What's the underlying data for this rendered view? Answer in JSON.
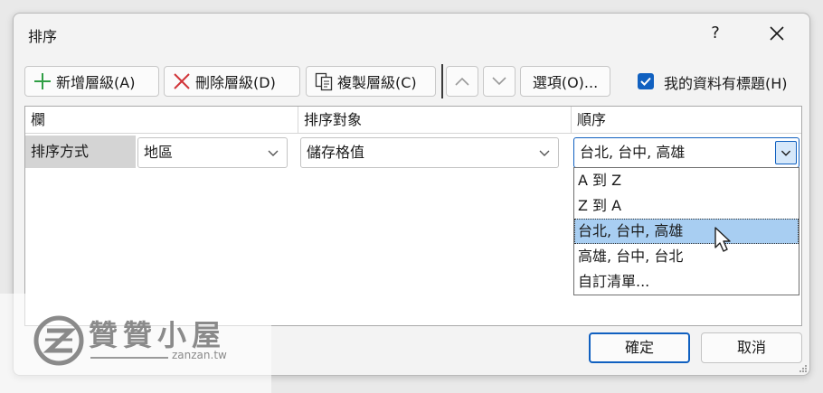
{
  "dialog": {
    "title": "排序",
    "help_label": "?"
  },
  "toolbar": {
    "add_level": "新增層級(A)",
    "delete_level": "刪除層級(D)",
    "copy_level": "複製層級(C)",
    "options": "選項(O)...",
    "header_checkbox_label": "我的資料有標題(H)",
    "header_checkbox_checked": true
  },
  "grid": {
    "headers": {
      "column": "欄",
      "sort_on": "排序對象",
      "order": "順序"
    },
    "row": {
      "label": "排序方式",
      "column_value": "地區",
      "sort_on_value": "儲存格值",
      "order_value": "台北, 台中, 高雄"
    }
  },
  "order_dropdown": {
    "options": [
      "A 到 Z",
      "Z 到 A",
      "台北, 台中, 高雄",
      "高雄, 台中, 台北",
      "自訂清單..."
    ],
    "selected_index": 2
  },
  "buttons": {
    "ok": "確定",
    "cancel": "取消"
  },
  "watermark": {
    "title": "贊贊小屋",
    "url": "zanzan.tw"
  },
  "colors": {
    "accent": "#1060c0",
    "selection": "#a8cef2",
    "add_icon": "#2f9e44",
    "delete_icon": "#d13438"
  }
}
